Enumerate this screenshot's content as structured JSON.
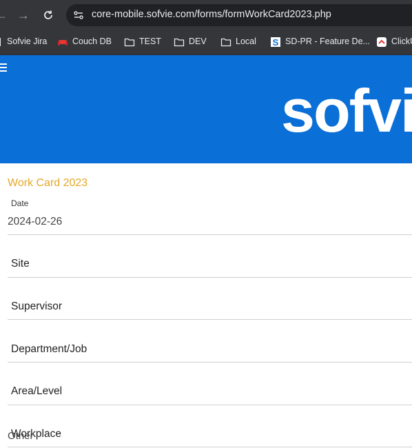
{
  "browser": {
    "url": "core-mobile.sofvie.com/forms/formWorkCard2023.php",
    "bookmarks": [
      {
        "label": "Sofvie Jira",
        "icon": "page-icon"
      },
      {
        "label": "Couch DB",
        "icon": "couch-icon"
      },
      {
        "label": "TEST",
        "icon": "folder-icon"
      },
      {
        "label": "DEV",
        "icon": "folder-icon"
      },
      {
        "label": "Local",
        "icon": "folder-icon"
      },
      {
        "label": "SD-PR - Feature De...",
        "icon": "sofvie-s-icon"
      },
      {
        "label": "ClickU",
        "icon": "clickup-icon"
      }
    ]
  },
  "banner": {
    "brand": "sofvi",
    "color": "#0a6fd6"
  },
  "form": {
    "title": "Work Card 2023",
    "title_color": "#e4a72a",
    "date_label": "Date",
    "date_value": "2024-02-26",
    "fields": [
      {
        "label": "Site"
      },
      {
        "label": "Supervisor"
      },
      {
        "label": "Department/Job"
      },
      {
        "label": "Area/Level"
      },
      {
        "label": "Workplace"
      }
    ],
    "other_label": "Other"
  }
}
